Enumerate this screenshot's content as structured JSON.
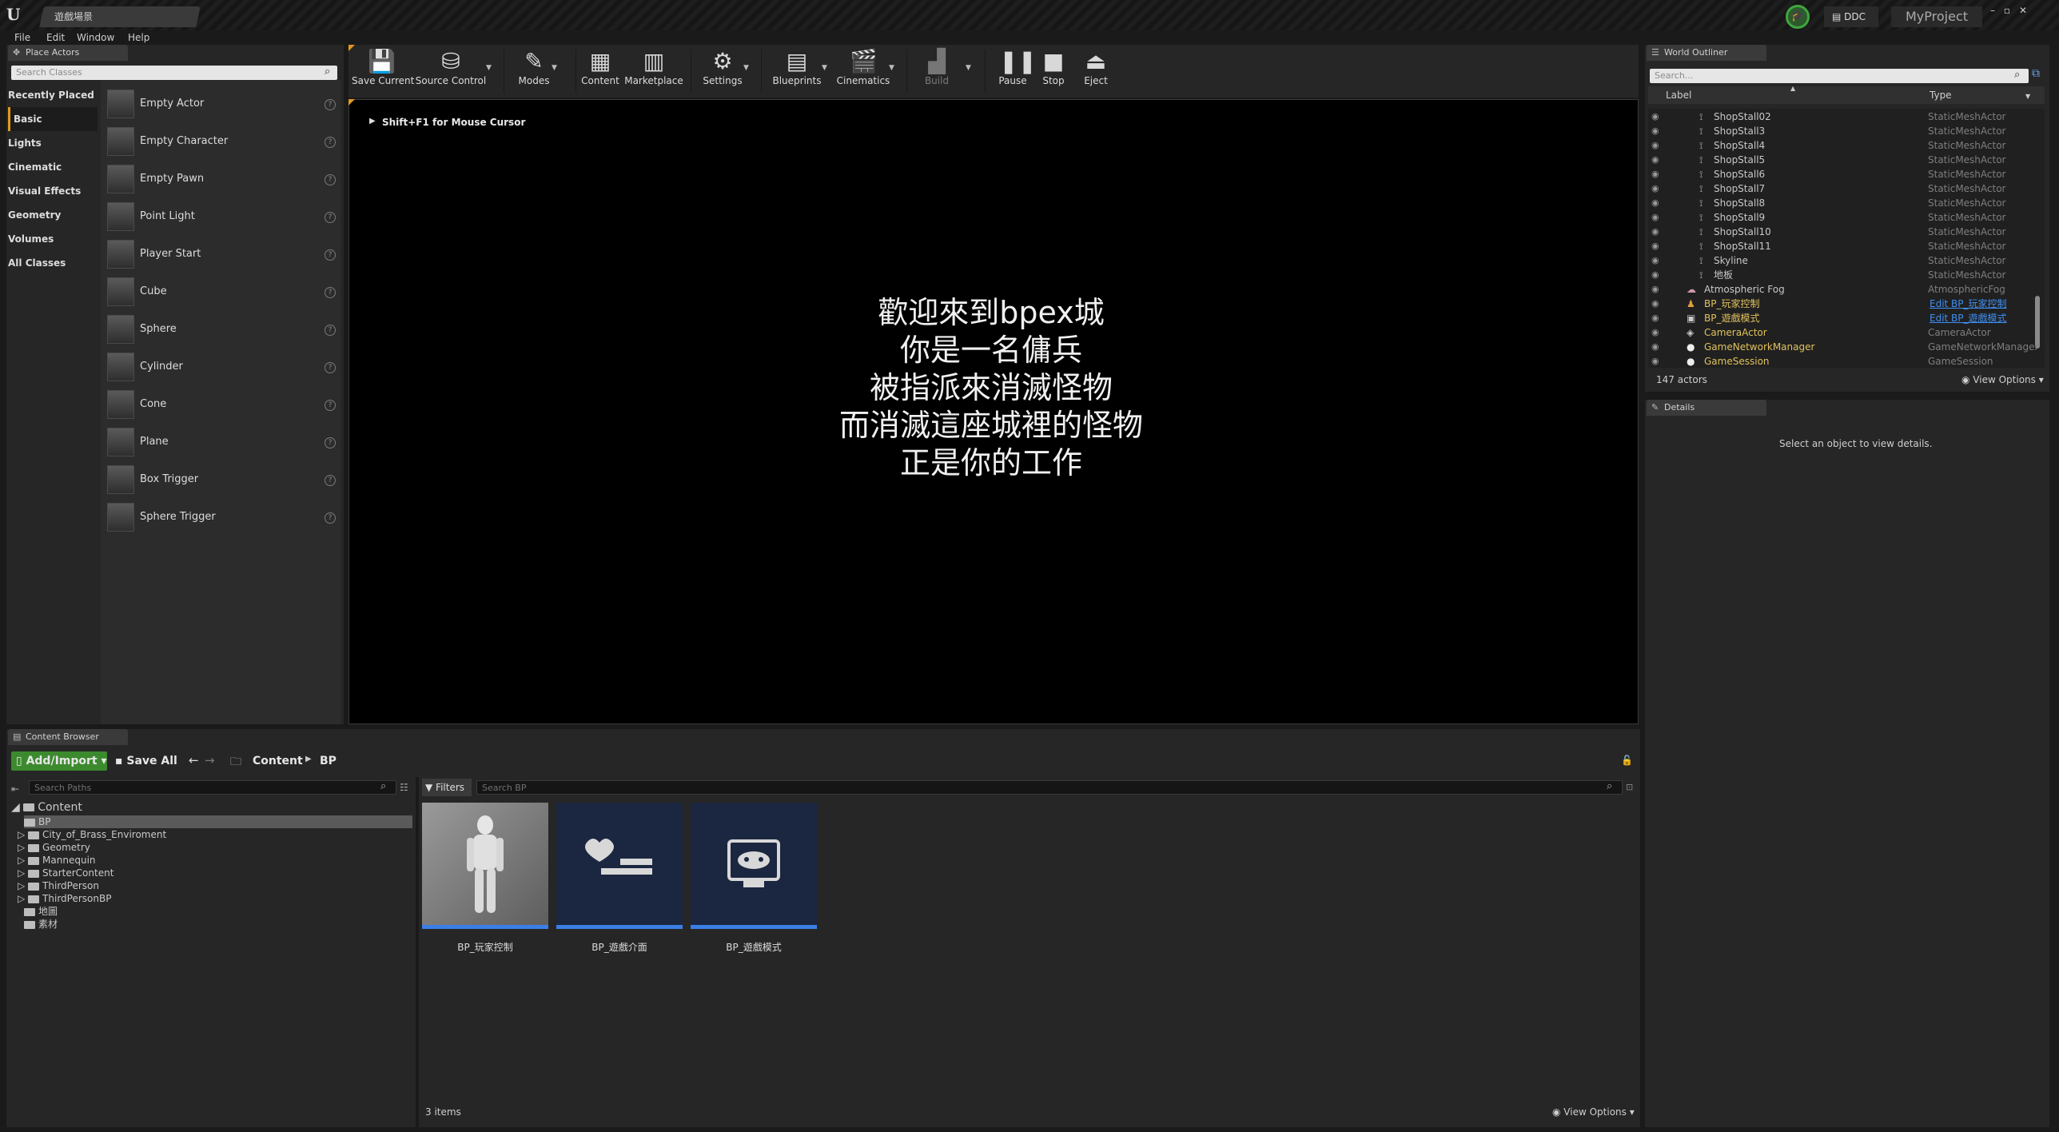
{
  "window": {
    "map_tab": "遊戲場景",
    "ddc": "DDC",
    "project": "MyProject",
    "min": "–",
    "max": "▫",
    "close": "✕"
  },
  "menu": [
    "File",
    "Edit",
    "Window",
    "Help"
  ],
  "place_actors": {
    "tab": "Place Actors",
    "search_placeholder": "Search Classes",
    "categories": [
      "Recently Placed",
      "Basic",
      "Lights",
      "Cinematic",
      "Visual Effects",
      "Geometry",
      "Volumes",
      "All Classes"
    ],
    "active_category": "Basic",
    "items": [
      "Empty Actor",
      "Empty Character",
      "Empty Pawn",
      "Point Light",
      "Player Start",
      "Cube",
      "Sphere",
      "Cylinder",
      "Cone",
      "Plane",
      "Box Trigger",
      "Sphere Trigger"
    ]
  },
  "toolbar": {
    "save_current": "Save Current",
    "source_control": "Source Control",
    "modes": "Modes",
    "content": "Content",
    "marketplace": "Marketplace",
    "settings": "Settings",
    "blueprints": "Blueprints",
    "cinematics": "Cinematics",
    "build": "Build",
    "pause": "Pause",
    "stop": "Stop",
    "eject": "Eject"
  },
  "viewport": {
    "hint": "Shift+F1 for Mouse Cursor",
    "lines": [
      "歡迎來到bpex城",
      "你是一名傭兵",
      "被指派來消滅怪物",
      "而消滅這座城裡的怪物",
      "正是你的工作"
    ]
  },
  "outliner": {
    "tab": "World Outliner",
    "search_placeholder": "Search...",
    "col_label": "Label",
    "col_type": "Type",
    "rows": [
      {
        "label": "ShopStall02",
        "type": "StaticMeshActor"
      },
      {
        "label": "ShopStall3",
        "type": "StaticMeshActor"
      },
      {
        "label": "ShopStall4",
        "type": "StaticMeshActor"
      },
      {
        "label": "ShopStall5",
        "type": "StaticMeshActor"
      },
      {
        "label": "ShopStall6",
        "type": "StaticMeshActor"
      },
      {
        "label": "ShopStall7",
        "type": "StaticMeshActor"
      },
      {
        "label": "ShopStall8",
        "type": "StaticMeshActor"
      },
      {
        "label": "ShopStall9",
        "type": "StaticMeshActor"
      },
      {
        "label": "ShopStall10",
        "type": "StaticMeshActor"
      },
      {
        "label": "ShopStall11",
        "type": "StaticMeshActor"
      },
      {
        "label": "Skyline",
        "type": "StaticMeshActor"
      },
      {
        "label": "地板",
        "type": "StaticMeshActor"
      },
      {
        "label": "Atmospheric Fog",
        "type": "AtmosphericFog"
      },
      {
        "label": "BP_玩家控制",
        "type": "Edit BP_玩家控制"
      },
      {
        "label": "BP_遊戲模式",
        "type": "Edit BP_遊戲模式"
      },
      {
        "label": "CameraActor",
        "type": "CameraActor"
      },
      {
        "label": "GameNetworkManager",
        "type": "GameNetworkManager"
      },
      {
        "label": "GameSession",
        "type": "GameSession"
      }
    ],
    "actor_count": "147 actors",
    "view_options": "View Options"
  },
  "details": {
    "tab": "Details",
    "empty_msg": "Select an object to view details."
  },
  "content_browser": {
    "tab": "Content Browser",
    "add_import": "Add/Import",
    "save_all": "Save All",
    "path_root": "Content",
    "path_leaf": "BP",
    "search_paths_placeholder": "Search Paths",
    "filters": "Filters",
    "search_assets_placeholder": "Search BP",
    "tree": [
      "Content",
      "BP",
      "City_of_Brass_Enviroment",
      "Geometry",
      "Mannequin",
      "StarterContent",
      "ThirdPerson",
      "ThirdPersonBP",
      "地圖",
      "素材"
    ],
    "assets": [
      "BP_玩家控制",
      "BP_遊戲介面",
      "BP_遊戲模式"
    ],
    "item_count": "3 items",
    "view_options": "View Options"
  },
  "colors": {
    "accent_orange": "#e09a1d",
    "add_import_green": "#3c8a2e",
    "link_blue": "#3f8ff0",
    "asset_underline": "#3b7ee6"
  }
}
